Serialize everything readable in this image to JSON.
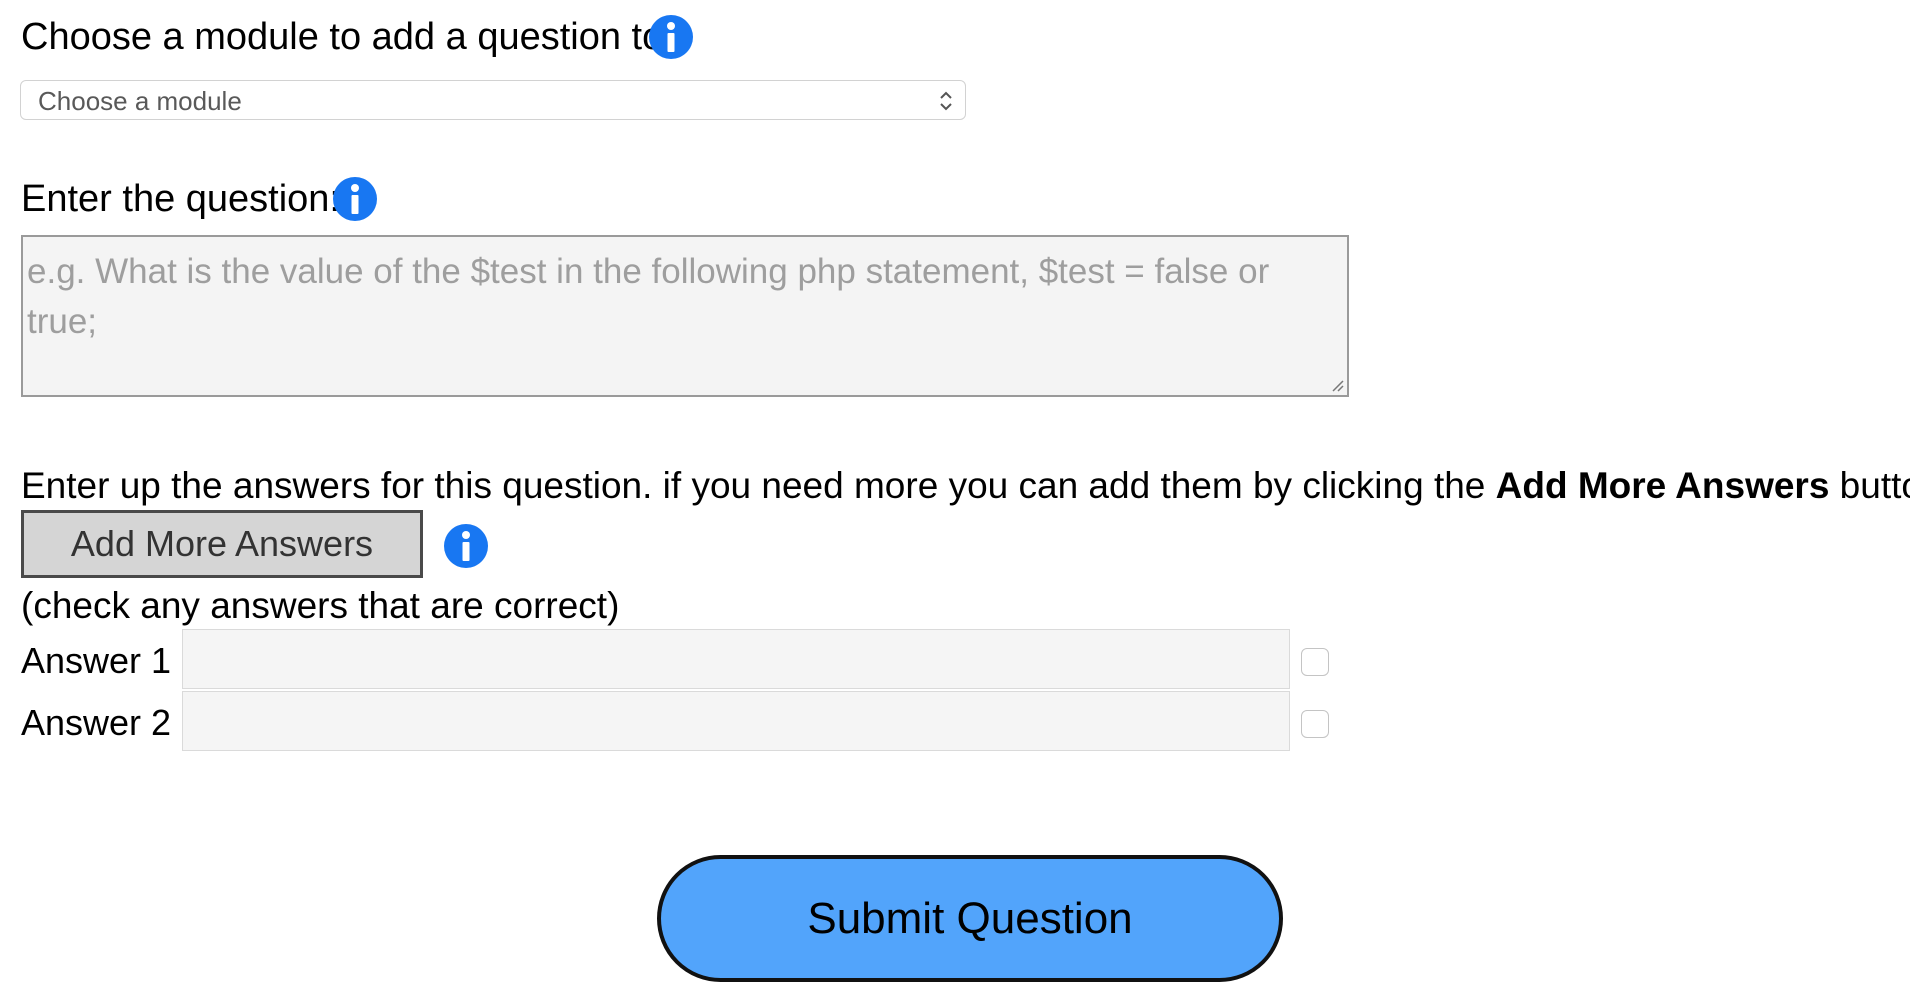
{
  "module_section": {
    "label": "Choose a module to add a question to:",
    "info_icon": "info-icon",
    "select_value": "Choose a module"
  },
  "question_section": {
    "label": "Enter the question:",
    "info_icon": "info-icon",
    "placeholder": "e.g. What is the value of the $test in the following php statement, $test  = false or true;"
  },
  "answers_section": {
    "intro_text": "Enter up the answers for this question. if you need more you can add them by clicking the ",
    "intro_bold": "Add More Answers",
    "intro_suffix": " button",
    "add_more_label": "Add More Answers",
    "info_icon": "info-icon",
    "note": "(check any answers that are correct)",
    "answers": [
      {
        "label": "Answer 1",
        "value": "",
        "checked": false
      },
      {
        "label": "Answer 2",
        "value": "",
        "checked": false
      }
    ]
  },
  "submit": {
    "label": "Submit Question"
  },
  "colors": {
    "info_icon": "#1877f2",
    "submit_background": "#52a4fb",
    "add_more_background": "#d5d5d5"
  }
}
